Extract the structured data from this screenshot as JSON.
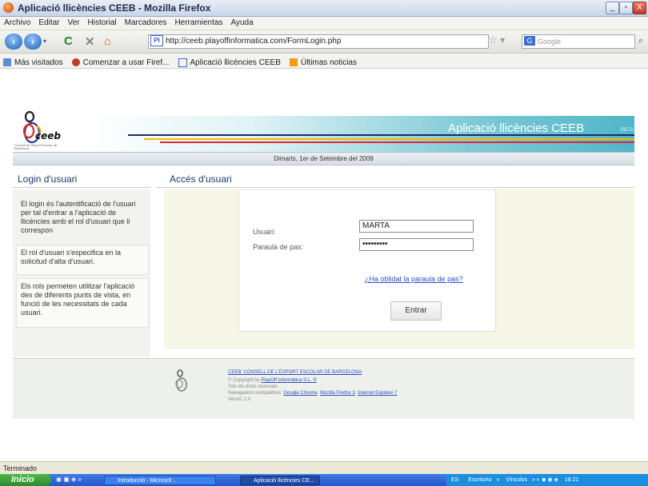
{
  "window": {
    "title": "Aplicació llicències CEEB - Mozilla Firefox",
    "buttons": {
      "minimize": "_",
      "maximize": "▫",
      "close": "X"
    }
  },
  "menu": [
    "Archivo",
    "Editar",
    "Ver",
    "Historial",
    "Marcadores",
    "Herramientas",
    "Ayuda"
  ],
  "nav": {
    "url": "http://ceeb.playoffinformatica.com/FormLogin.php",
    "favicon_text": "PI",
    "search_placeholder": "Google"
  },
  "bookmarks": [
    {
      "label": "Más visitados",
      "icon": "bookmark-folder-icon"
    },
    {
      "label": "Comenzar a usar Firef...",
      "icon": "firefox-icon"
    },
    {
      "label": "Aplicació llicències CEEB",
      "icon": "pi-favicon-icon"
    },
    {
      "label": "Últimas noticias",
      "icon": "rss-icon"
    }
  ],
  "site": {
    "logo_text": "ceeb",
    "logo_subtitle": "Consell de l'Esport Escolar de Barcelona",
    "app_title": "Aplicació llicències CEEB",
    "beta": "(BETA)",
    "date": "Dimarts, 1er de Setembre del 2009"
  },
  "sidebar": {
    "title": "Login d'usuari",
    "intro": "El login és l'autentificació de l'usuari per tal d'entrar a l'aplicació de llicències amb el rol d'usuari que li correspon",
    "card1": "El rol d'usuari s'especifica en la solicitud d'alta d'usuari.",
    "card2": "Els rols permeten utilitzar l'aplicació des de diferents punts de vista, en funció de les necessitats de cada usuari."
  },
  "login": {
    "section_title": "Accés d'usuari",
    "user_label": "Usuari:",
    "user_value": "MARTA",
    "password_label": "Paraula de pas:",
    "password_value": "•••••••••",
    "forgot": "¿Ha oblidat la paraula de pas?",
    "submit": "Entrar"
  },
  "footer": {
    "org_link": "CEEB: CONSELL DE L'ESPORT ESCOLAR DE BARCELONA",
    "copyright_prefix": "© Copyright by",
    "copyright_link": "PlayOff Informàtica S.L. ®",
    "rights": "Tots els drets reservats.",
    "browsers_prefix": "Navegadors compatibles:",
    "browser1": "Google Chrome",
    "browser2": "Mozilla Firefox 3",
    "browser3": "Internet Explorer 7",
    "version": "Versió: 1.0"
  },
  "status": "Terminado",
  "taskbar": {
    "start": "Inicio",
    "tasks": [
      "Introducció - Microsof...",
      "Aplicació llicències CE..."
    ],
    "tray": {
      "lang": "ES",
      "desktop": "Escritorio",
      "links": "Vínculos",
      "time": "18:21"
    }
  },
  "colors": {
    "accent": "#4fb6c7",
    "link": "#2a4fc0",
    "heading": "#1a3a6a"
  }
}
